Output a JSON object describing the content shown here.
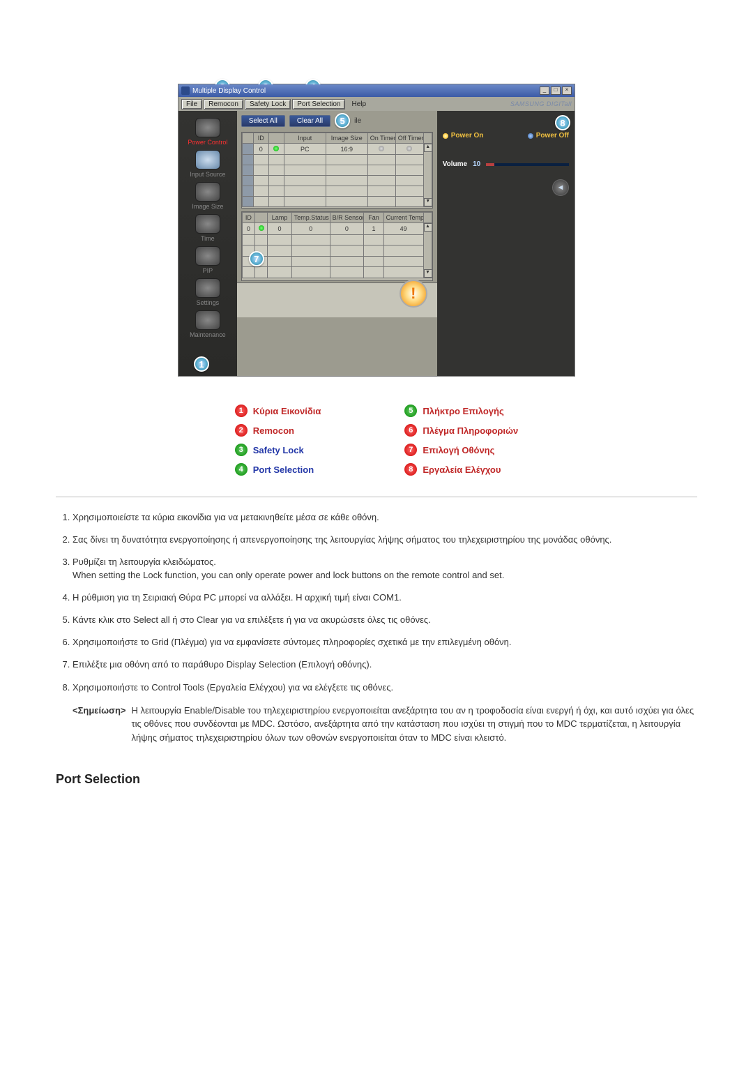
{
  "window": {
    "title": "Multiple Display Control",
    "brand": "SAMSUNG DIGITall"
  },
  "menu": {
    "file": "File",
    "remocon": "Remocon",
    "safety_lock": "Safety Lock",
    "port_selection": "Port Selection",
    "help": "Help"
  },
  "sidebar": {
    "power": "Power Control",
    "input": "Input Source",
    "image": "Image Size",
    "time": "Time",
    "pip": "PIP",
    "settings": "Settings",
    "maintenance": "Maintenance"
  },
  "toolbar": {
    "select_all": "Select All",
    "clear_all": "Clear All",
    "suffix": "ile"
  },
  "grid1": {
    "headers": [
      "ID",
      "",
      "Input",
      "Image Size",
      "On Timer",
      "Off Timer"
    ],
    "row": {
      "id": "0",
      "input": "PC",
      "image_size": "16:9"
    }
  },
  "grid2": {
    "headers": [
      "ID",
      "",
      "Lamp",
      "Temp.Status",
      "B/R Sensor",
      "Fan",
      "Current Temp."
    ],
    "row": {
      "id": "0",
      "lamp": "0",
      "temp_status": "0",
      "br": "0",
      "fan": "1",
      "cur": "49"
    }
  },
  "panel": {
    "power_on": "Power On",
    "power_off": "Power Off",
    "volume_label": "Volume",
    "volume_value": "10"
  },
  "legend": {
    "l1": "Κύρια Εικονίδια",
    "l2": "Remocon",
    "l3": "Safety Lock",
    "l4": "Port Selection",
    "l5": "Πλήκτρο Επιλογής",
    "l6": "Πλέγμα Πληροφοριών",
    "l7": "Επιλογή Οθόνης",
    "l8": "Εργαλεία Ελέγχου"
  },
  "notes": {
    "n1": "Χρησιμοποιείστε τα κύρια εικονίδια για να μετακινηθείτε μέσα σε κάθε οθόνη.",
    "n2": "Σας δίνει τη δυνατότητα ενεργοποίησης ή απενεργοποίησης της λειτουργίας λήψης σήματος του τηλεχειριστηρίου της μονάδας οθόνης.",
    "n3a": "Ρυθμίζει τη λειτουργία κλειδώματος.",
    "n3b": "When setting the Lock function, you can only operate power and lock buttons on the remote control and set.",
    "n4": "Η ρύθμιση για τη Σειριακή Θύρα PC μπορεί να αλλάξει. Η αρχική τιμή είναι COM1.",
    "n5": "Κάντε κλικ στο Select all ή στο Clear για να επιλέξετε ή για να ακυρώσετε όλες τις οθόνες.",
    "n6": "Χρησιμοποιήστε το Grid (Πλέγμα) για να εμφανίσετε σύντομες πληροφορίες σχετικά με την επιλεγμένη οθόνη.",
    "n7": "Επιλέξτε μια οθόνη από το παράθυρο Display Selection (Επιλογή οθόνης).",
    "n8": "Χρησιμοποιήστε το Control Tools (Εργαλεία Ελέγχου) για να ελέγξετε τις οθόνες."
  },
  "note_block": {
    "key": "<Σημείωση>",
    "text": "Η λειτουργία Enable/Disable του τηλεχειριστηρίου ενεργοποιείται ανεξάρτητα του αν η τροφοδοσία είναι ενεργή ή όχι, και αυτό ισχύει για όλες τις οθόνες που συνδέονται με MDC. Ωστόσο, ανεξάρτητα από την κατάσταση που ισχύει τη στιγμή που το MDC τερματίζεται, η λειτουργία λήψης σήματος τηλεχειριστηρίου όλων των οθονών ενεργοποιείται όταν το MDC είναι κλειστό."
  },
  "section_heading": "Port Selection"
}
